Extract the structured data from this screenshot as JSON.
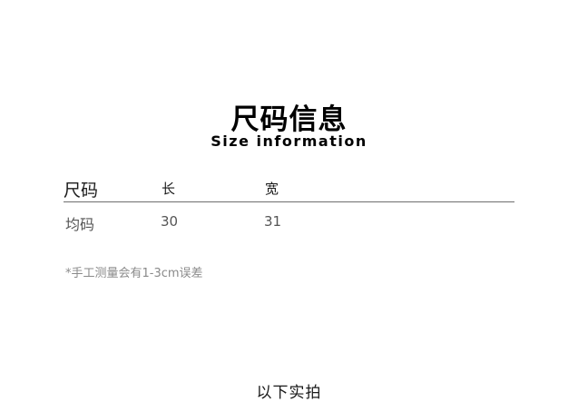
{
  "heading": {
    "title_zh": "尺码信息",
    "title_en": "Size information"
  },
  "table": {
    "columns": [
      "尺码",
      "长",
      "宽"
    ],
    "rows": [
      [
        "均码",
        "30",
        "31"
      ]
    ]
  },
  "note": "*手工测量会有1-3cm误差",
  "footer": "以下实拍"
}
